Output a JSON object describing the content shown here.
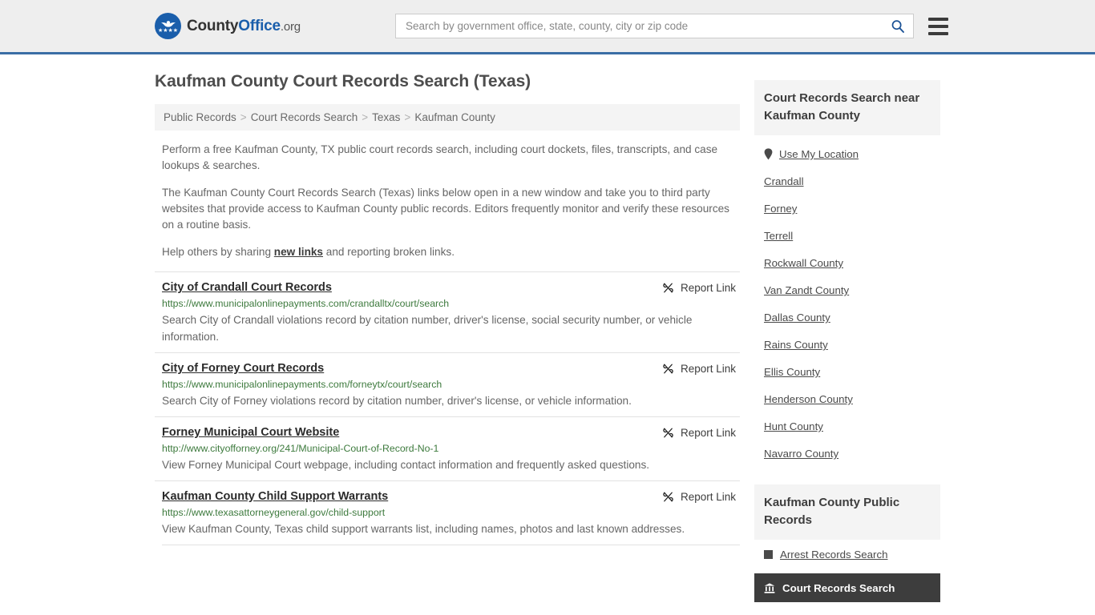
{
  "header": {
    "logo": {
      "icon": "eagle-seal-icon",
      "stars": "★★★★",
      "text_county": "County",
      "text_office": "Office",
      "text_tld": ".org"
    },
    "search": {
      "placeholder": "Search by government office, state, county, city or zip code",
      "value": "",
      "search_icon": "search-icon"
    },
    "menu_icon": "hamburger-menu-icon"
  },
  "main": {
    "title": "Kaufman County Court Records Search (Texas)",
    "breadcrumb": [
      "Public Records",
      "Court Records Search",
      "Texas",
      "Kaufman County"
    ],
    "breadcrumb_separator": ">",
    "intro": {
      "p1": "Perform a free Kaufman County, TX public court records search, including court dockets, files, transcripts, and case lookups & searches.",
      "p2": "The Kaufman County Court Records Search (Texas) links below open in a new window and take you to third party websites that provide access to Kaufman County public records. Editors frequently monitor and verify these resources on a routine basis.",
      "p3_before": "Help others by sharing ",
      "p3_link": "new links",
      "p3_after": " and reporting broken links."
    },
    "report_link_label": "Report Link",
    "report_link_icon": "broken-link-icon",
    "results": [
      {
        "title": "City of Crandall Court Records",
        "url": "https://www.municipalonlinepayments.com/crandalltx/court/search",
        "description": "Search City of Crandall violations record by citation number, driver's license, social security number, or vehicle information."
      },
      {
        "title": "City of Forney Court Records",
        "url": "https://www.municipalonlinepayments.com/forneytx/court/search",
        "description": "Search City of Forney violations record by citation number, driver's license, or vehicle information."
      },
      {
        "title": "Forney Municipal Court Website",
        "url": "http://www.cityofforney.org/241/Municipal-Court-of-Record-No-1",
        "description": "View Forney Municipal Court webpage, including contact information and frequently asked questions."
      },
      {
        "title": "Kaufman County Child Support Warrants",
        "url": "https://www.texasattorneygeneral.gov/child-support",
        "description": "View Kaufman County, Texas child support warrants list, including names, photos and last known addresses."
      }
    ]
  },
  "sidebar": {
    "nearby": {
      "heading": "Court Records Search near Kaufman County",
      "use_my_location": {
        "label": "Use My Location",
        "icon": "map-pin-icon"
      },
      "items": [
        "Crandall",
        "Forney",
        "Terrell",
        "Rockwall County",
        "Van Zandt County",
        "Dallas County",
        "Rains County",
        "Ellis County",
        "Henderson County",
        "Hunt County",
        "Navarro County"
      ]
    },
    "public_records": {
      "heading": "Kaufman County Public Records",
      "items": [
        {
          "label": "Arrest Records Search",
          "icon": "square-icon",
          "active": false
        },
        {
          "label": "Court Records Search",
          "icon": "courthouse-icon",
          "active": true
        }
      ]
    }
  },
  "colors": {
    "brand_blue": "#1a5eab",
    "header_rule": "#3a6ea5",
    "url_green": "#3d7a3d",
    "panel_gray": "#f4f4f4",
    "active_dark": "#3d3d3d"
  }
}
